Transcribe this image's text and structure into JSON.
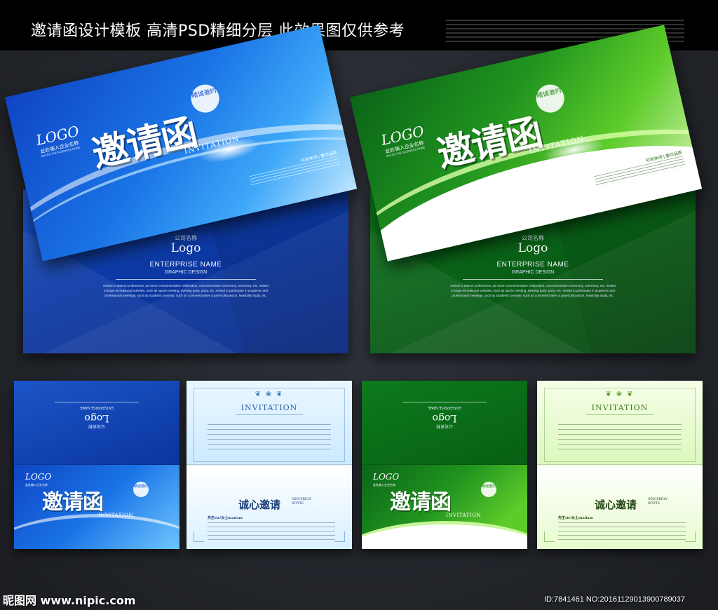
{
  "header": {
    "title": "邀请函设计模板 高清PSD精细分层 此效果图仅供参考"
  },
  "card": {
    "logo": "LOGO",
    "logo_sub_cn": "此处输入企业名称",
    "logo_sub_en": "ENTER THE BUSINESS NAME",
    "headline": "邀请函",
    "headline_en": "INVITATION",
    "badge": "精诚邀约",
    "tagline": "时尚休闲 | 奢华品质"
  },
  "back": {
    "company_cn": "公司名称",
    "logo": "Logo",
    "enterprise_name": "ENTERPRISE NAME",
    "graphic_design": "GRAPHIC DESIGN",
    "paragraph": "Invited to attend conferences, as some commemorative celebration, commemoration ceremony, ceremony, etc. Invited to large recreational activities, such as sports meeting, evening party, party, etc. Invited to participate in academic and professional meetings, such as academic seminar, such as commemorative a panel discussion, feasibility study, etc."
  },
  "inner": {
    "title": "INVITATION",
    "ornament": "❦ ❀ ❦",
    "sincere_cn": "诚心邀请",
    "sincere_en": "SINCERELY INVITE",
    "salute": "先生sir/女士madam"
  },
  "watermark": {
    "left": "昵图网 www.nipic.com",
    "right": "ID:7841461 NO:20161129013900789037"
  },
  "colors": {
    "blue_primary": "#0f44c4",
    "green_primary": "#0a6418",
    "page_bg": "#1d1f24"
  }
}
